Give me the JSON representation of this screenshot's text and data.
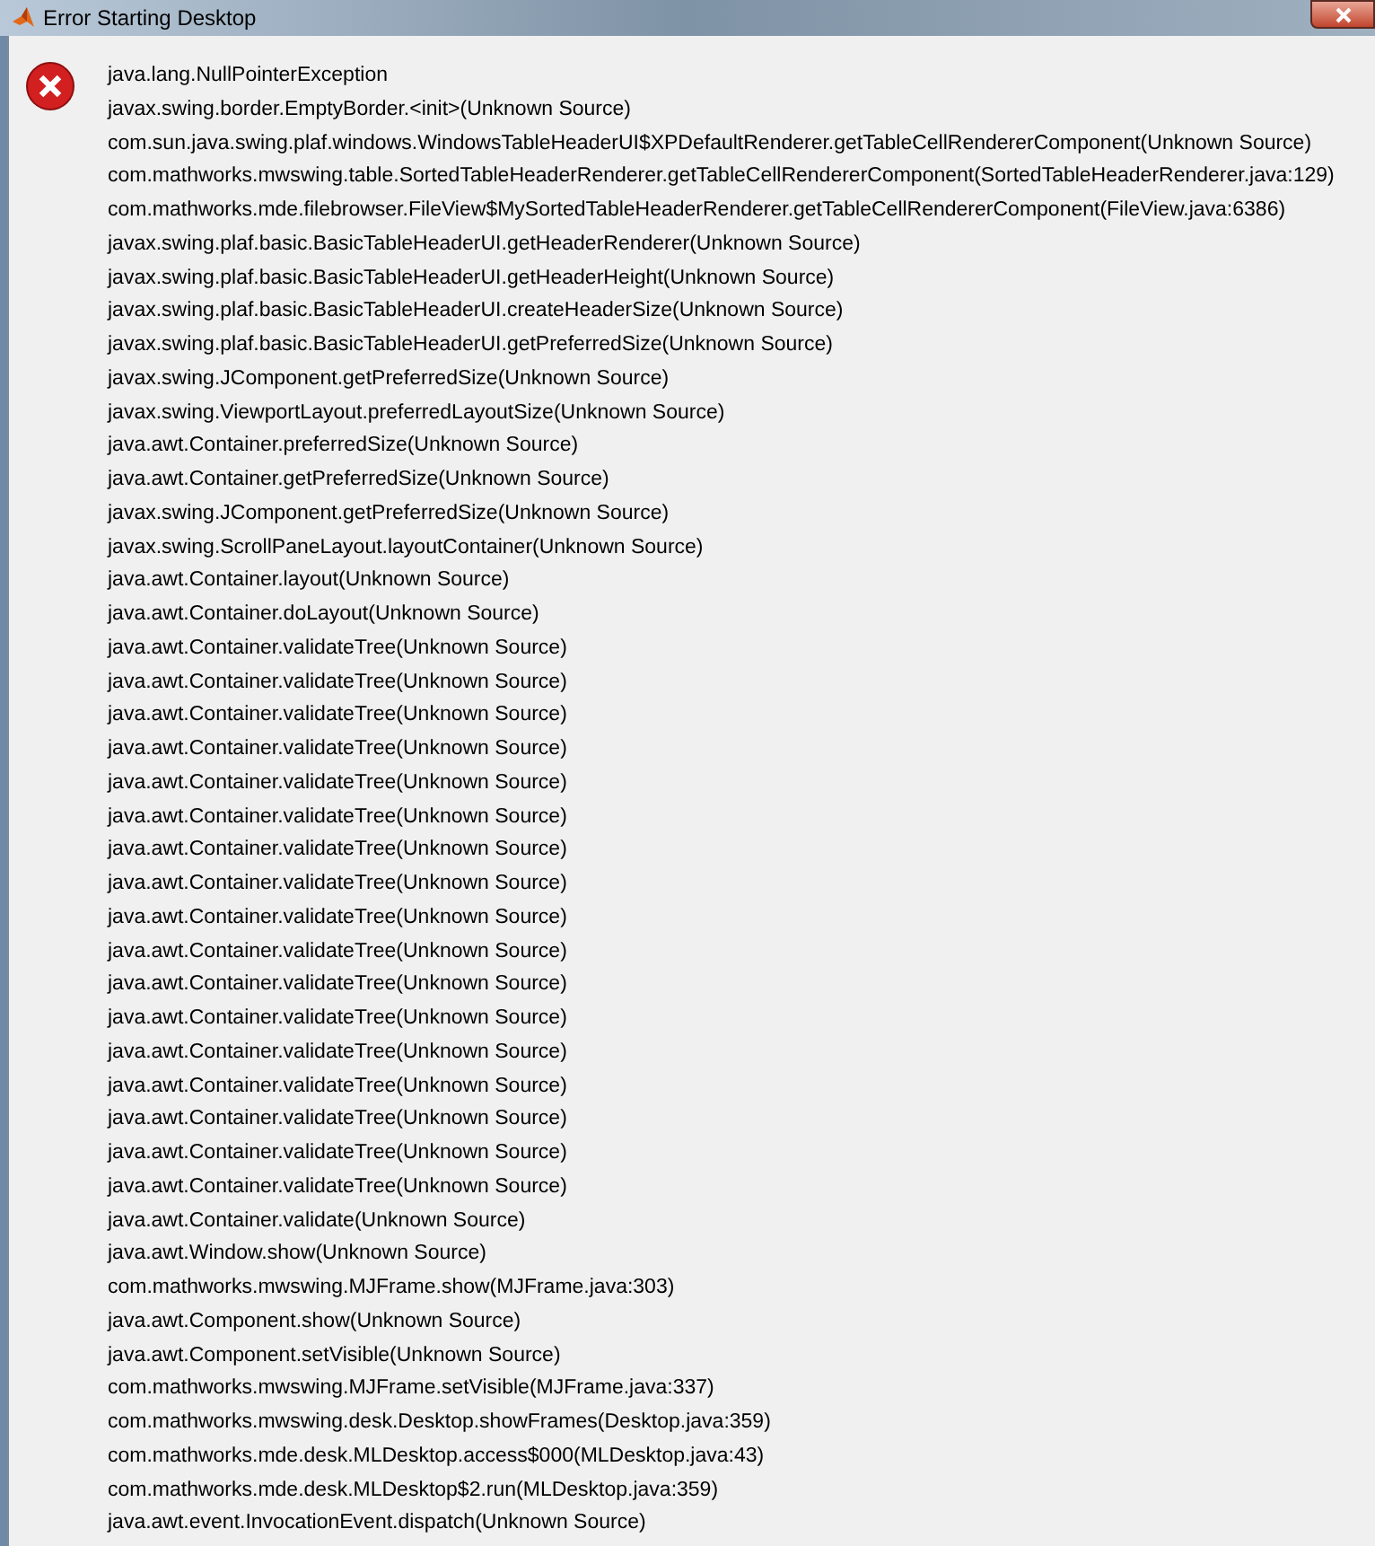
{
  "window": {
    "title": "Error Starting Desktop"
  },
  "message": {
    "kind": "error",
    "lines": [
      "java.lang.NullPointerException",
      "javax.swing.border.EmptyBorder.<init>(Unknown Source)",
      "com.sun.java.swing.plaf.windows.WindowsTableHeaderUI$XPDefaultRenderer.getTableCellRendererComponent(Unknown Source)",
      "com.mathworks.mwswing.table.SortedTableHeaderRenderer.getTableCellRendererComponent(SortedTableHeaderRenderer.java:129)",
      "com.mathworks.mde.filebrowser.FileView$MySortedTableHeaderRenderer.getTableCellRendererComponent(FileView.java:6386)",
      "javax.swing.plaf.basic.BasicTableHeaderUI.getHeaderRenderer(Unknown Source)",
      "javax.swing.plaf.basic.BasicTableHeaderUI.getHeaderHeight(Unknown Source)",
      "javax.swing.plaf.basic.BasicTableHeaderUI.createHeaderSize(Unknown Source)",
      "javax.swing.plaf.basic.BasicTableHeaderUI.getPreferredSize(Unknown Source)",
      "javax.swing.JComponent.getPreferredSize(Unknown Source)",
      "javax.swing.ViewportLayout.preferredLayoutSize(Unknown Source)",
      "java.awt.Container.preferredSize(Unknown Source)",
      "java.awt.Container.getPreferredSize(Unknown Source)",
      "javax.swing.JComponent.getPreferredSize(Unknown Source)",
      "javax.swing.ScrollPaneLayout.layoutContainer(Unknown Source)",
      "java.awt.Container.layout(Unknown Source)",
      "java.awt.Container.doLayout(Unknown Source)",
      "java.awt.Container.validateTree(Unknown Source)",
      "java.awt.Container.validateTree(Unknown Source)",
      "java.awt.Container.validateTree(Unknown Source)",
      "java.awt.Container.validateTree(Unknown Source)",
      "java.awt.Container.validateTree(Unknown Source)",
      "java.awt.Container.validateTree(Unknown Source)",
      "java.awt.Container.validateTree(Unknown Source)",
      "java.awt.Container.validateTree(Unknown Source)",
      "java.awt.Container.validateTree(Unknown Source)",
      "java.awt.Container.validateTree(Unknown Source)",
      "java.awt.Container.validateTree(Unknown Source)",
      "java.awt.Container.validateTree(Unknown Source)",
      "java.awt.Container.validateTree(Unknown Source)",
      "java.awt.Container.validateTree(Unknown Source)",
      "java.awt.Container.validateTree(Unknown Source)",
      "java.awt.Container.validateTree(Unknown Source)",
      "java.awt.Container.validateTree(Unknown Source)",
      "java.awt.Container.validate(Unknown Source)",
      "java.awt.Window.show(Unknown Source)",
      "com.mathworks.mwswing.MJFrame.show(MJFrame.java:303)",
      "java.awt.Component.show(Unknown Source)",
      "java.awt.Component.setVisible(Unknown Source)",
      "com.mathworks.mwswing.MJFrame.setVisible(MJFrame.java:337)",
      "com.mathworks.mwswing.desk.Desktop.showFrames(Desktop.java:359)",
      "com.mathworks.mde.desk.MLDesktop.access$000(MLDesktop.java:43)",
      "com.mathworks.mde.desk.MLDesktop$2.run(MLDesktop.java:359)",
      "java.awt.event.InvocationEvent.dispatch(Unknown Source)"
    ]
  }
}
